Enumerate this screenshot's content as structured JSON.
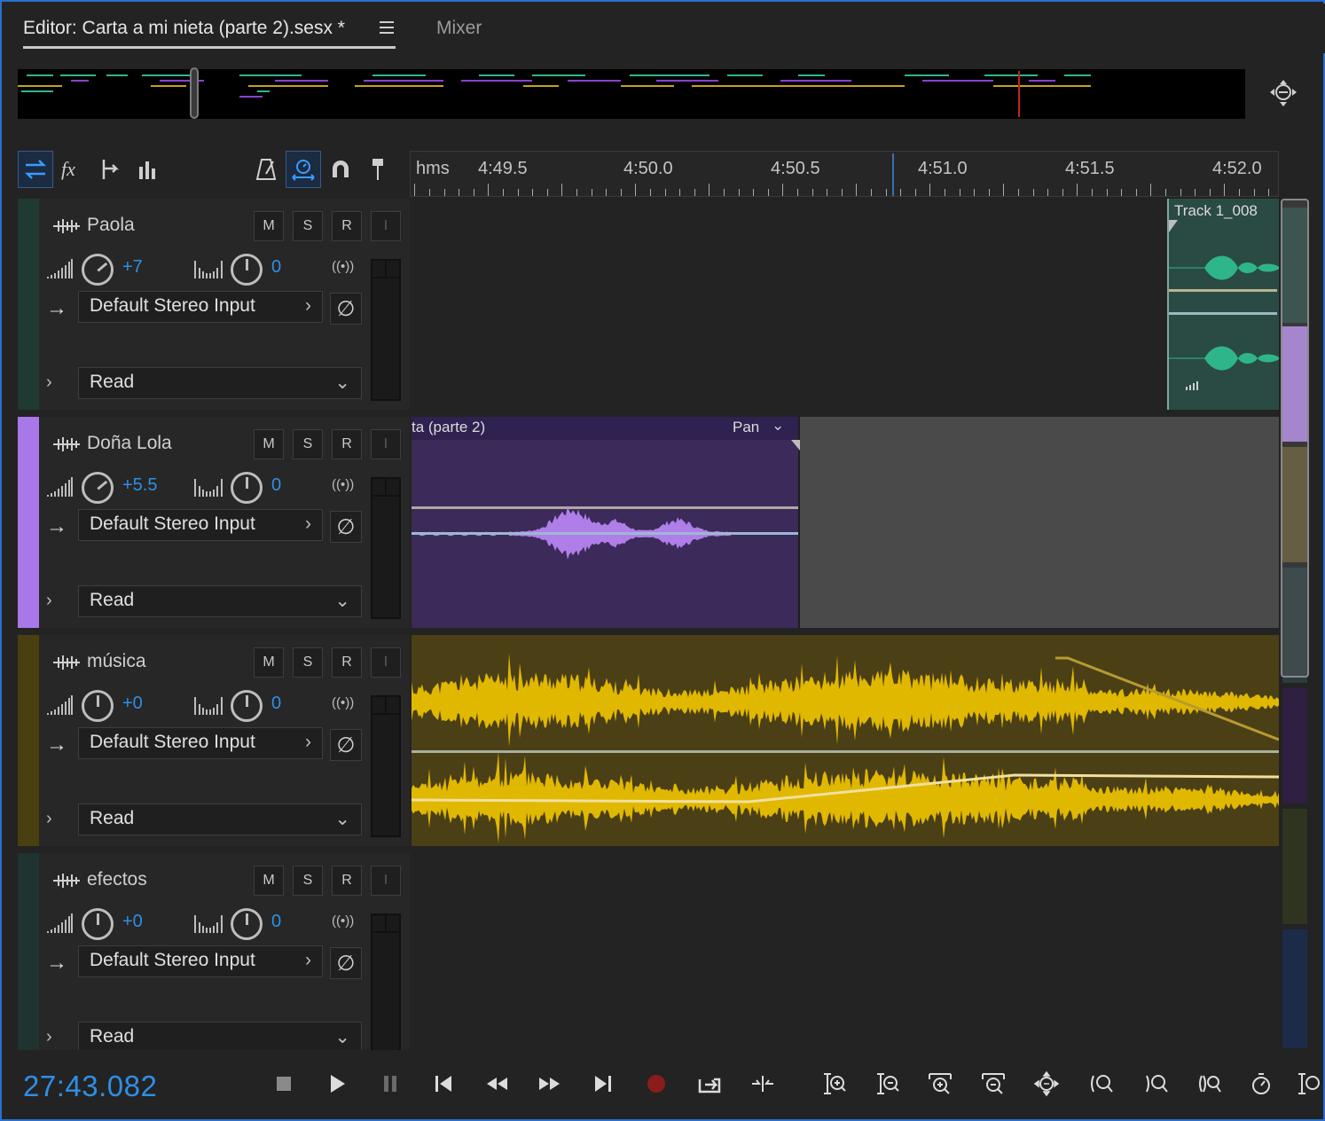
{
  "tabs": {
    "editor_label": "Editor: Carta a mi nieta (parte 2).sesx *",
    "mixer_label": "Mixer"
  },
  "ruler": {
    "unit": "hms",
    "labels": [
      "4:49.5",
      "4:50.0",
      "4:50.5",
      "4:51.0",
      "4:51.5",
      "4:52.0"
    ]
  },
  "buttons": {
    "mute": "M",
    "solo": "S",
    "record": "R",
    "input": "I"
  },
  "tracks": [
    {
      "name": "Paola",
      "volume": "+7",
      "pan": "0",
      "input": "Default Stereo Input",
      "automation": "Read",
      "color": "#1e3a32"
    },
    {
      "name": "Doña Lola",
      "volume": "+5.5",
      "pan": "0",
      "input": "Default Stereo Input",
      "automation": "Read",
      "color": "#a878e8"
    },
    {
      "name": "música",
      "volume": "+0",
      "pan": "0",
      "input": "Default Stereo Input",
      "automation": "Read",
      "color": "#4a3f10"
    },
    {
      "name": "efectos",
      "volume": "+0",
      "pan": "0",
      "input": "Default Stereo Input",
      "automation": "Read",
      "color": "#1f3330"
    }
  ],
  "clips": {
    "paola_clip": "Track 1_008",
    "lola_clip": "ta (parte 2)",
    "lola_param": "Pan"
  },
  "transport": {
    "timecode": "27:43.082"
  },
  "colors": {
    "accent": "#2e8fe6",
    "lola_wave": "#b07ee8",
    "music_wave": "#e1b800",
    "paola_wave": "#2fb58a"
  }
}
